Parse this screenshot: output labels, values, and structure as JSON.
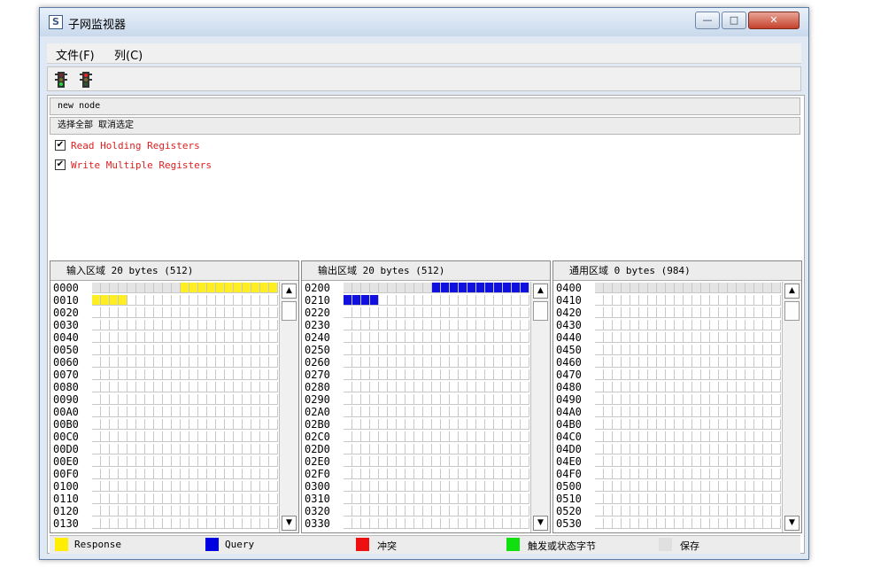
{
  "window": {
    "title": "子网监视器",
    "controls": {
      "minimize": "—",
      "maximize": "□",
      "close": "✕"
    }
  },
  "menu": [
    {
      "label": "文件(F)"
    },
    {
      "label": "列(C)"
    }
  ],
  "toolbar": {
    "icons": [
      "traffic-light-green-icon",
      "traffic-light-red-icon"
    ]
  },
  "node_label": "new node",
  "select_actions": "选择全部 取消选定",
  "functions": [
    {
      "label": "Read Holding Registers",
      "checked": true
    },
    {
      "label": "Write Multiple Registers",
      "checked": true
    }
  ],
  "areas": [
    {
      "header": "输入区域 20 bytes (512)",
      "fill_color": "#ffee22",
      "rows": [
        "0000",
        "0010",
        "0020",
        "0030",
        "0040",
        "0050",
        "0060",
        "0070",
        "0080",
        "0090",
        "00A0",
        "00B0",
        "00C0",
        "00D0",
        "00E0",
        "00F0",
        "0100",
        "0110",
        "0120",
        "0130"
      ],
      "filled": [
        [
          0,
          10
        ],
        [
          0,
          11
        ],
        [
          0,
          12
        ],
        [
          0,
          13
        ],
        [
          0,
          14
        ],
        [
          0,
          15
        ],
        [
          0,
          16
        ],
        [
          0,
          17
        ],
        [
          0,
          18
        ],
        [
          0,
          19
        ],
        [
          0,
          20
        ],
        [
          0,
          21
        ],
        [
          0,
          22
        ],
        [
          0,
          23
        ],
        [
          0,
          24
        ],
        [
          0,
          25
        ],
        [
          1,
          0
        ],
        [
          1,
          1
        ],
        [
          1,
          2
        ],
        [
          1,
          3
        ]
      ]
    },
    {
      "header": "输出区域 20 bytes (512)",
      "fill_color": "#1010e0",
      "rows": [
        "0200",
        "0210",
        "0220",
        "0230",
        "0240",
        "0250",
        "0260",
        "0270",
        "0280",
        "0290",
        "02A0",
        "02B0",
        "02C0",
        "02D0",
        "02E0",
        "02F0",
        "0300",
        "0310",
        "0320",
        "0330"
      ],
      "filled": [
        [
          0,
          10
        ],
        [
          0,
          11
        ],
        [
          0,
          12
        ],
        [
          0,
          13
        ],
        [
          0,
          14
        ],
        [
          0,
          15
        ],
        [
          0,
          16
        ],
        [
          0,
          17
        ],
        [
          0,
          18
        ],
        [
          0,
          19
        ],
        [
          0,
          20
        ],
        [
          0,
          21
        ],
        [
          0,
          22
        ],
        [
          0,
          23
        ],
        [
          0,
          24
        ],
        [
          0,
          25
        ],
        [
          1,
          0
        ],
        [
          1,
          1
        ],
        [
          1,
          2
        ],
        [
          1,
          3
        ]
      ]
    },
    {
      "header": "通用区域 0 bytes (984)",
      "fill_color": "#ffffff",
      "rows": [
        "0400",
        "0410",
        "0420",
        "0430",
        "0440",
        "0450",
        "0460",
        "0470",
        "0480",
        "0490",
        "04A0",
        "04B0",
        "04C0",
        "04D0",
        "04E0",
        "04F0",
        "0500",
        "0510",
        "0520",
        "0530"
      ],
      "filled": []
    }
  ],
  "legend": [
    {
      "label": "Response",
      "color": "#ffee00"
    },
    {
      "label": "Query",
      "color": "#0000e0"
    },
    {
      "label": "冲突",
      "color": "#ee1010"
    },
    {
      "label": "触发或状态字节",
      "color": "#10e010"
    },
    {
      "label": "保存",
      "color": "#e0e0e0"
    }
  ]
}
